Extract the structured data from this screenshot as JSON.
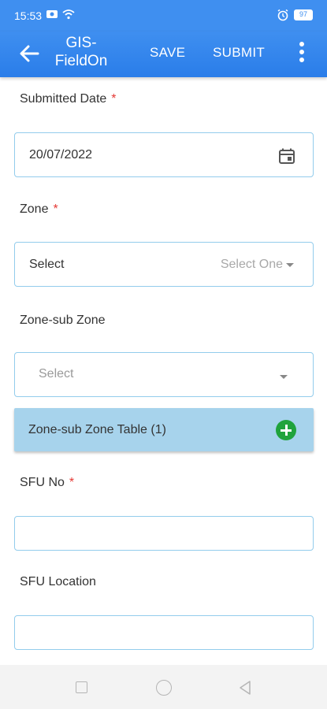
{
  "status_bar": {
    "time": "15:53",
    "battery": "97"
  },
  "app_bar": {
    "title": "GIS-FieldOn",
    "save": "SAVE",
    "submit": "SUBMIT"
  },
  "form": {
    "submitted_date": {
      "label": "Submitted Date",
      "required": "*",
      "value": "20/07/2022"
    },
    "zone": {
      "label": "Zone",
      "required": "*",
      "value": "Select",
      "hint": "Select One"
    },
    "zone_sub_zone": {
      "label": "Zone-sub Zone",
      "placeholder": "Select"
    },
    "zone_sub_zone_table": {
      "label": "Zone-sub Zone Table (1)"
    },
    "sfu_no": {
      "label": "SFU No",
      "required": "*",
      "value": ""
    },
    "sfu_location": {
      "label": "SFU Location",
      "value": ""
    }
  },
  "colors": {
    "primary": "#3f8ff0",
    "field_border": "#93ccec",
    "table_bar": "#a7d3ec",
    "add_button": "#20a33c",
    "required": "#e53935"
  },
  "icons": [
    "back-arrow-icon",
    "more-vert-icon",
    "calendar-icon",
    "dropdown-caret-icon",
    "add-circle-icon"
  ]
}
